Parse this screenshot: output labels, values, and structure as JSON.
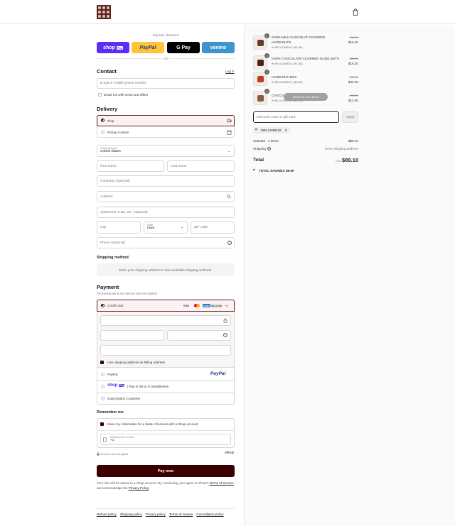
{
  "header": {
    "logo_icon": "store-logo",
    "bag_icon": "shopping-bag-icon"
  },
  "express": {
    "title": "Express checkout",
    "shop_pay": "shop",
    "shop_pay_badge": "Pay",
    "paypal": "PayPal",
    "gpay": "G Pay",
    "venmo": "venmo",
    "or": "OR"
  },
  "contact": {
    "title": "Contact",
    "login": "Log in",
    "email_placeholder": "Email or mobile phone number",
    "news_label": "Email me with news and offers"
  },
  "delivery": {
    "title": "Delivery",
    "ship": "Ship",
    "pickup": "Pickup in store",
    "country_label": "Country/Region",
    "country_value": "United States",
    "first_name": "First name",
    "last_name": "Last name",
    "company": "Company (optional)",
    "address": "Address",
    "apartment": "Apartment, suite, etc. (optional)",
    "city": "City",
    "state_label": "State",
    "state_value": "Iowa",
    "zip": "ZIP code",
    "phone": "Phone (optional)"
  },
  "shipping_method": {
    "title": "Shipping method",
    "message": "Enter your shipping address to view available shipping methods."
  },
  "payment": {
    "title": "Payment",
    "subtitle": "All transactions are secure and encrypted.",
    "credit_card": "Credit card",
    "more_cards": "+4",
    "use_shipping": "Use shipping address as billing address",
    "paypal": "PayPal",
    "paypal_logo": "PayPal",
    "shop_pay_text": "| Pay in full or in installments",
    "shop_logo": "shop",
    "shop_badge": "Pay",
    "subscription": "Subscription Customer"
  },
  "remember": {
    "title": "Remember me",
    "save_label": "Save my information for a faster checkout with a Shop account",
    "mobile_label": "Mobile phone number",
    "mobile_value": "+1",
    "secure": "Secured and encrypted",
    "shop": "shop"
  },
  "pay_now": "Pay now",
  "legal": {
    "text1": "Your info will be saved to a Shop account. By continuing, you agree to Shop's",
    "terms": "Terms of Service",
    "text2": "and acknowledge the",
    "privacy": "Privacy Policy",
    "end": "."
  },
  "footer": [
    "Refund policy",
    "Shipping policy",
    "Privacy policy",
    "Terms of service",
    "Cancellation policy"
  ],
  "cart": {
    "items": [
      {
        "name": "DARK MILK CHOCOLAT-COVERED",
        "name2": "HAZELNUTS",
        "discount": "WELCOME10 (-$1.80)",
        "old_price": "$18.00",
        "price": "$16.20",
        "qty": "1"
      },
      {
        "name": "DARK CHOCOLATE-COVERED HAZELNUTS",
        "name2": "",
        "discount": "WELCOME10 (-$1.80)",
        "old_price": "$18.00",
        "price": "$16.20",
        "qty": "1"
      },
      {
        "name": "HAZELNUT BOX",
        "name2": "",
        "discount": "WELCOME10 (-$4.80)",
        "old_price": "$48.00",
        "price": "$43.20",
        "qty": "1"
      },
      {
        "name": "CHOCO",
        "name2": "",
        "discount": "WELCOME10 (-$1.50)",
        "old_price": "$15.00",
        "price": "$13.50",
        "qty": "1"
      }
    ],
    "scroll_hint": "Scroll for more items",
    "discount_placeholder": "Discount code or gift card",
    "apply": "Apply",
    "tag": "WELCOME10",
    "subtotal_label": "Subtotal · 4 items",
    "subtotal": "$89.10",
    "shipping_label": "Shipping",
    "shipping_value": "Enter shipping address",
    "total_label": "Total",
    "currency": "USD",
    "total": "$89.10",
    "savings_label": "TOTAL SAVINGS",
    "savings": "$9.90"
  }
}
